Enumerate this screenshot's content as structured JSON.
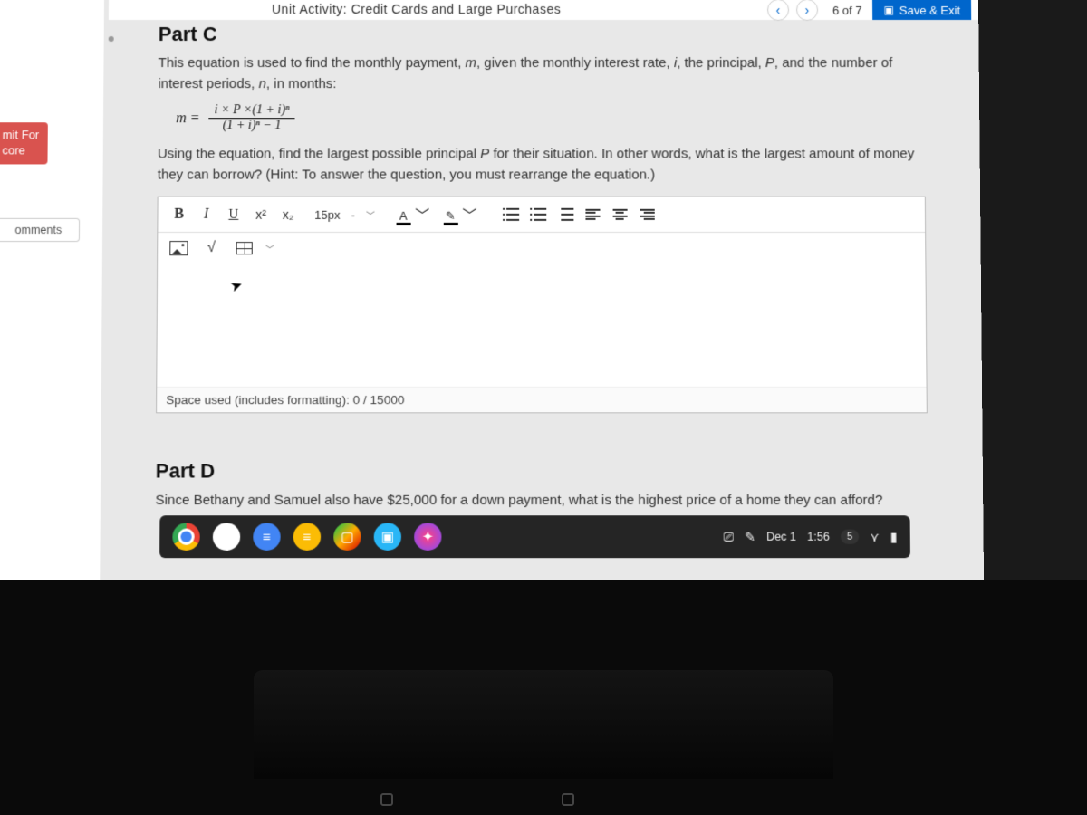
{
  "header": {
    "breadcrumb": "Unit Activity: Credit Cards and Large Purchases",
    "page_indicator": "6 of 7",
    "save_exit": "Save & Exit"
  },
  "sidebar": {
    "submit_line1": "mit For",
    "submit_line2": "core",
    "comments": "omments"
  },
  "partC": {
    "title": "Part C",
    "intro_a": "This equation is used to find the monthly payment, ",
    "intro_m": "m",
    "intro_b": ", given the monthly interest rate, ",
    "intro_i": "i",
    "intro_c": ", the principal, ",
    "intro_P": "P",
    "intro_d": ", and the number of interest periods, ",
    "intro_n": "n",
    "intro_e": ", in months:",
    "eq_lhs": "m  =",
    "eq_num": "i × P ×(1 + i)ⁿ",
    "eq_den": "(1 + i)ⁿ − 1",
    "prompt_a": "Using the equation, find the largest possible principal ",
    "prompt_P": "P",
    "prompt_b": " for their situation. In other words, what is the largest amount of money they can borrow? (Hint: To answer the question, you must rearrange the equation.)"
  },
  "editor": {
    "bold": "B",
    "italic": "I",
    "underline": "U",
    "sup_label": "x²",
    "sub_label": "x₂",
    "fontsize": "15px",
    "textcolor_letter": "A",
    "highlight_letter": "✎",
    "sqrt": "√",
    "space_used": "Space used (includes formatting): 0 / 15000"
  },
  "partD": {
    "title": "Part D",
    "text": "Since Bethany and Samuel also have $25,000 for a down payment, what is the highest price of a home they can afford?"
  },
  "shelf": {
    "date": "Dec 1",
    "time": "1:56"
  }
}
